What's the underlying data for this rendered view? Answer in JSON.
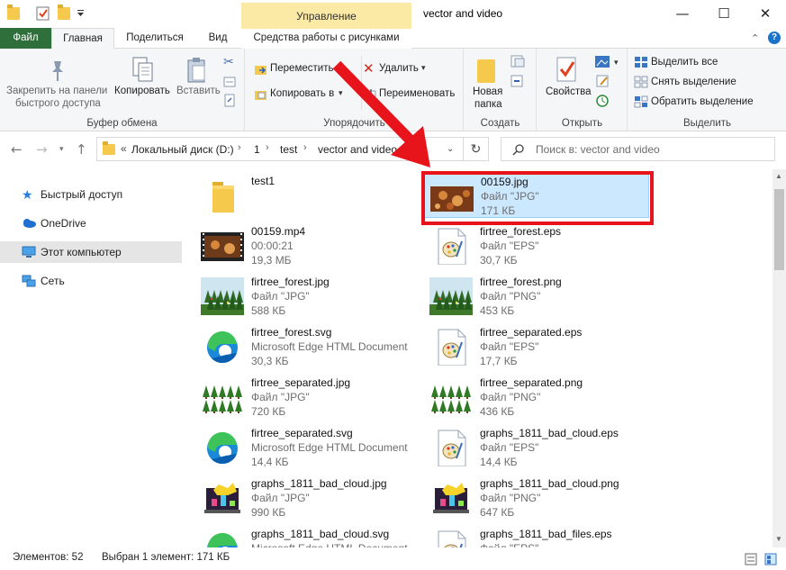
{
  "window": {
    "title": "vector and video",
    "context_tab_header": "Управление",
    "minimize": "—",
    "maximize": "☐",
    "close": "✕"
  },
  "tabs": {
    "file": "Файл",
    "home": "Главная",
    "share": "Поделиться",
    "view": "Вид",
    "picture_tools": "Средства работы с рисунками"
  },
  "ribbon": {
    "clipboard": {
      "pin_line1": "Закрепить на панели",
      "pin_line2": "быстрого доступа",
      "copy": "Копировать",
      "paste": "Вставить",
      "label": "Буфер обмена"
    },
    "organize": {
      "move_to": "Переместить в",
      "copy_to": "Копировать в",
      "delete": "Удалить",
      "rename": "Переименовать",
      "label": "Упорядочить"
    },
    "new": {
      "new_folder_line1": "Новая",
      "new_folder_line2": "папка",
      "label": "Создать"
    },
    "open": {
      "properties": "Свойства",
      "label": "Открыть"
    },
    "select": {
      "select_all": "Выделить все",
      "select_none": "Снять выделение",
      "invert": "Обратить выделение",
      "label": "Выделить"
    }
  },
  "address": {
    "chevron": "«",
    "crumbs": [
      "Локальный диск (D:)",
      "1",
      "test",
      "vector and video"
    ],
    "search_placeholder": "Поиск в: vector and video"
  },
  "nav": {
    "quick_access": "Быстрый доступ",
    "onedrive": "OneDrive",
    "this_pc": "Этот компьютер",
    "network": "Сеть"
  },
  "files": [
    {
      "name": "test1",
      "type": "",
      "size": "",
      "kind": "folder"
    },
    {
      "name": "00159.jpg",
      "type": "Файл \"JPG\"",
      "size": "171 КБ",
      "kind": "photo-brown",
      "selected": true
    },
    {
      "name": "00159.mp4",
      "type": "00:00:21",
      "size": "19,3 МБ",
      "kind": "video"
    },
    {
      "name": "firtree_forest.eps",
      "type": "Файл \"EPS\"",
      "size": "30,7 КБ",
      "kind": "eps"
    },
    {
      "name": "firtree_forest.jpg",
      "type": "Файл \"JPG\"",
      "size": "588 КБ",
      "kind": "forest"
    },
    {
      "name": "firtree_forest.png",
      "type": "Файл \"PNG\"",
      "size": "453 КБ",
      "kind": "forest"
    },
    {
      "name": "firtree_forest.svg",
      "type": "Microsoft Edge HTML Document",
      "size": "30,3 КБ",
      "kind": "edge"
    },
    {
      "name": "firtree_separated.eps",
      "type": "Файл \"EPS\"",
      "size": "17,7 КБ",
      "kind": "eps"
    },
    {
      "name": "firtree_separated.jpg",
      "type": "Файл \"JPG\"",
      "size": "720 КБ",
      "kind": "trees"
    },
    {
      "name": "firtree_separated.png",
      "type": "Файл \"PNG\"",
      "size": "436 КБ",
      "kind": "trees"
    },
    {
      "name": "firtree_separated.svg",
      "type": "Microsoft Edge HTML Document",
      "size": "14,4 КБ",
      "kind": "edge"
    },
    {
      "name": "graphs_1811_bad_cloud.eps",
      "type": "Файл \"EPS\"",
      "size": "14,4 КБ",
      "kind": "eps"
    },
    {
      "name": "graphs_1811_bad_cloud.jpg",
      "type": "Файл \"JPG\"",
      "size": "990 КБ",
      "kind": "graph"
    },
    {
      "name": "graphs_1811_bad_cloud.png",
      "type": "Файл \"PNG\"",
      "size": "647 КБ",
      "kind": "graph"
    },
    {
      "name": "graphs_1811_bad_cloud.svg",
      "type": "Microsoft Edge HTML Document",
      "size": "",
      "kind": "edge"
    },
    {
      "name": "graphs_1811_bad_files.eps",
      "type": "Файл \"EPS\"",
      "size": "",
      "kind": "eps"
    }
  ],
  "status": {
    "items": "Элементов: 52",
    "selected": "Выбран 1 элемент: 171 КБ"
  },
  "colors": {
    "file_tab": "#2f6f3b",
    "context_tab": "#fbeaa6",
    "selection": "#cce8ff",
    "annotation": "#e8141c"
  }
}
